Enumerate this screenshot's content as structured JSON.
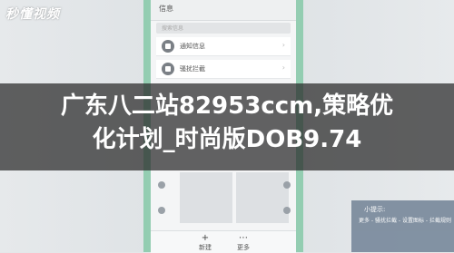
{
  "watermark": "秒懂视频",
  "phone": {
    "header_title": "信息",
    "search_placeholder": "搜索信息",
    "rows": [
      {
        "label": "通知信息",
        "icon": "notification-icon"
      },
      {
        "label": "骚扰拦截",
        "icon": "shield-icon"
      }
    ],
    "footer": [
      {
        "label": "新建",
        "icon": "plus-icon",
        "glyph": "+"
      },
      {
        "label": "更多",
        "icon": "more-icon",
        "glyph": "⋯"
      }
    ]
  },
  "banner": {
    "line1": "广东八二站82953ccm,策略优",
    "line2": "化计划_时尚版DOB9.74"
  },
  "tip": {
    "title": "小提示:",
    "text": "更多 - 骚扰拦截 - 设置图标 - 拦截规则"
  },
  "colors": {
    "accent_green": "#7fc7a4",
    "banner_bg": "#282828",
    "tip_bg": "#7a8a9c"
  }
}
